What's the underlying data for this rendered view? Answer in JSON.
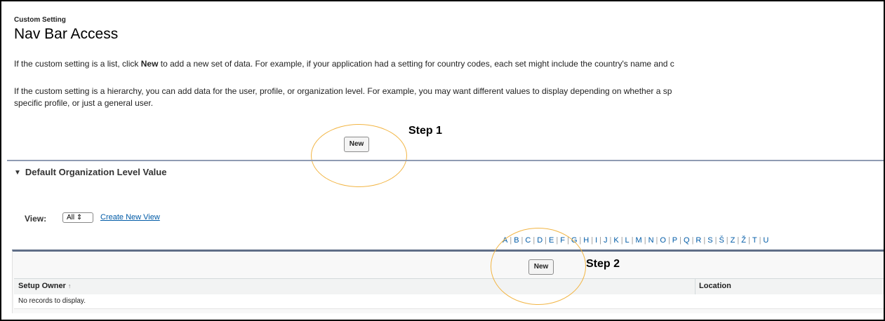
{
  "header": {
    "eyebrow": "Custom Setting",
    "title": "Nav Bar Access"
  },
  "intro": {
    "p1_before": "If the custom setting is a list, click ",
    "p1_bold": "New",
    "p1_after": " to add a new set of data. For example, if your application had a setting for country codes, each set might include the country's name and c",
    "p2_line1": "If the custom setting is a hierarchy, you can add data for the user, profile, or organization level. For example, you may want different values to display depending on whether a sp",
    "p2_line2": "specific profile, or just a general user."
  },
  "buttons": {
    "new_top": "New",
    "new_list": "New"
  },
  "annotations": {
    "step1": "Step 1",
    "step2": "Step 2",
    "circle_color": "#f2b544"
  },
  "section": {
    "title": "Default Organization Level Value",
    "toggle_icon": "triangle-down-icon"
  },
  "view": {
    "label": "View:",
    "selected": "All",
    "create_link": "Create New View"
  },
  "alphabet": [
    "A",
    "B",
    "C",
    "D",
    "E",
    "F",
    "G",
    "H",
    "I",
    "J",
    "K",
    "L",
    "M",
    "N",
    "O",
    "P",
    "Q",
    "R",
    "S",
    "Š",
    "Z",
    "Ž",
    "T",
    "U"
  ],
  "table": {
    "columns": [
      "Setup Owner",
      "Location"
    ],
    "sort_icon": "sort-ascending-icon",
    "empty_message": "No records to display."
  },
  "colors": {
    "link": "#015ba7",
    "divider": "#8f9bb3",
    "table_header_border": "#5f6e87"
  }
}
